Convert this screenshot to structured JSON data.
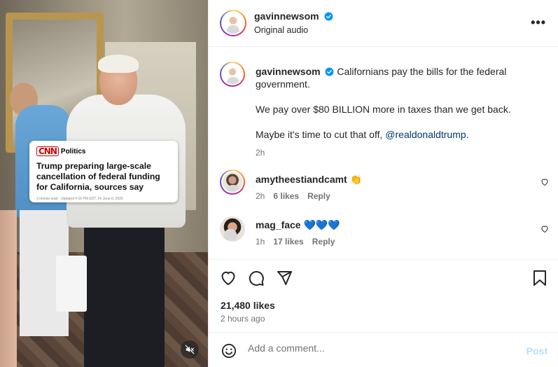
{
  "media": {
    "card": {
      "brand": "CNN",
      "section": "Politics",
      "headline": "Trump preparing large-scale cancellation of federal funding for California, sources say",
      "meta": "3 minute read · Updated 4:16 PM EDT, Fri June 6, 2025"
    },
    "mute_icon": "speaker-muted-icon"
  },
  "header": {
    "username": "gavinnewsom",
    "subtitle": "Original audio",
    "more_label": "•••"
  },
  "caption": {
    "username": "gavinnewsom",
    "line1": "Californians pay the bills for the federal government.",
    "line2": "We pay over $80 BILLION more in taxes than we get back.",
    "line3_prefix": "Maybe it's time to cut that off, ",
    "mention": "@realdonaldtrump",
    "line3_suffix": ".",
    "time": "2h"
  },
  "comments": [
    {
      "username": "amytheestiandcamt",
      "text": "👏",
      "time": "2h",
      "likes": "6 likes",
      "reply": "Reply"
    },
    {
      "username": "mag_face",
      "text": "💙💙💙",
      "time": "1h",
      "likes": "17 likes",
      "reply": "Reply"
    }
  ],
  "actions": {
    "likes": "21,480 likes",
    "time": "2 hours ago"
  },
  "composer": {
    "placeholder": "Add a comment...",
    "post_label": "Post"
  },
  "colors": {
    "verified": "#0095f6",
    "link": "#00376b",
    "post_disabled": "#b2dffc"
  }
}
